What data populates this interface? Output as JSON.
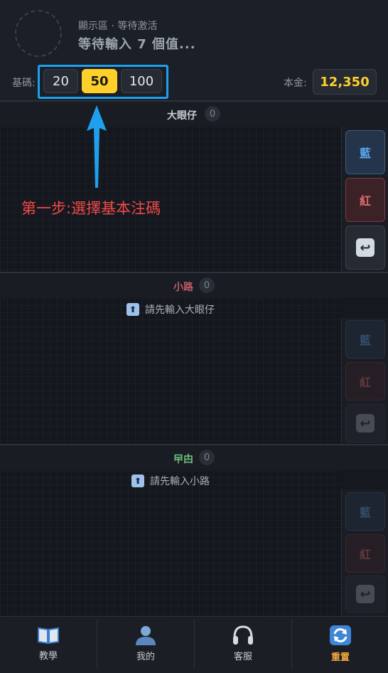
{
  "display": {
    "subtitle": "顯示區 · 等待激活",
    "main": "等待輸入 7 個值..."
  },
  "base": {
    "label": "基碼:",
    "chips": [
      "20",
      "50",
      "100"
    ],
    "selected": "50"
  },
  "capital": {
    "label": "本金:",
    "value": "12,350"
  },
  "annotation": "第一步:選擇基本注碼",
  "sections": [
    {
      "title": "大眼仔",
      "count": "0",
      "title_color": "#c9d0da",
      "hint": "",
      "buttons": {
        "blue": "藍",
        "red": "紅"
      },
      "disabled": false
    },
    {
      "title": "小路",
      "count": "0",
      "title_color": "#c05a66",
      "hint": "請先輸入大眼仔",
      "buttons": {
        "blue": "藍",
        "red": "紅"
      },
      "disabled": true
    },
    {
      "title": "曱甴",
      "count": "0",
      "title_color": "#6bbf7f",
      "hint": "請先輸入小路",
      "buttons": {
        "blue": "藍",
        "red": "紅"
      },
      "disabled": true
    }
  ],
  "icons": {
    "undo": "undo-icon",
    "hint": "up-arrow-icon"
  },
  "tabs": [
    {
      "label": "教學",
      "icon": "book-icon",
      "active": false
    },
    {
      "label": "我的",
      "icon": "user-icon",
      "active": false
    },
    {
      "label": "客服",
      "icon": "headset-icon",
      "active": false
    },
    {
      "label": "重置",
      "icon": "reset-icon",
      "active": true
    }
  ],
  "colors": {
    "accent": "#ffd02a",
    "highlight": "#1ea0ee",
    "annotation": "#f04a4a",
    "active_tab": "#f5a93b"
  }
}
